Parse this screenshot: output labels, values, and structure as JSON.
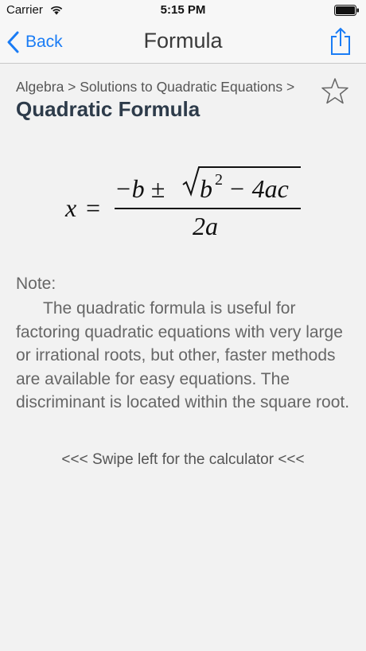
{
  "status_bar": {
    "carrier": "Carrier",
    "time": "5:15 PM"
  },
  "nav": {
    "back_label": "Back",
    "title": "Formula",
    "share_icon": "share-icon"
  },
  "breadcrumb": "Algebra > Solutions to Quadratic Equations >",
  "page_title": "Quadratic Formula",
  "favorite_icon": "star-outline-icon",
  "formula": {
    "lhs": "x",
    "equals": "=",
    "numerator_prefix": "−b ±",
    "radicand_b": "b",
    "radicand_exp": "2",
    "radicand_rest": "− 4ac",
    "denominator": "2a"
  },
  "note": {
    "label": "Note:",
    "body": "The quadratic formula is useful for factoring quadratic equations with very large or irrational roots, but other, faster methods are available for easy equations. The discriminant is located within the square root."
  },
  "swipe_hint": "<<< Swipe left for the calculator <<<",
  "colors": {
    "accent": "#1a7cf5",
    "title": "#2d3b4a",
    "background": "#f2f2f2"
  }
}
